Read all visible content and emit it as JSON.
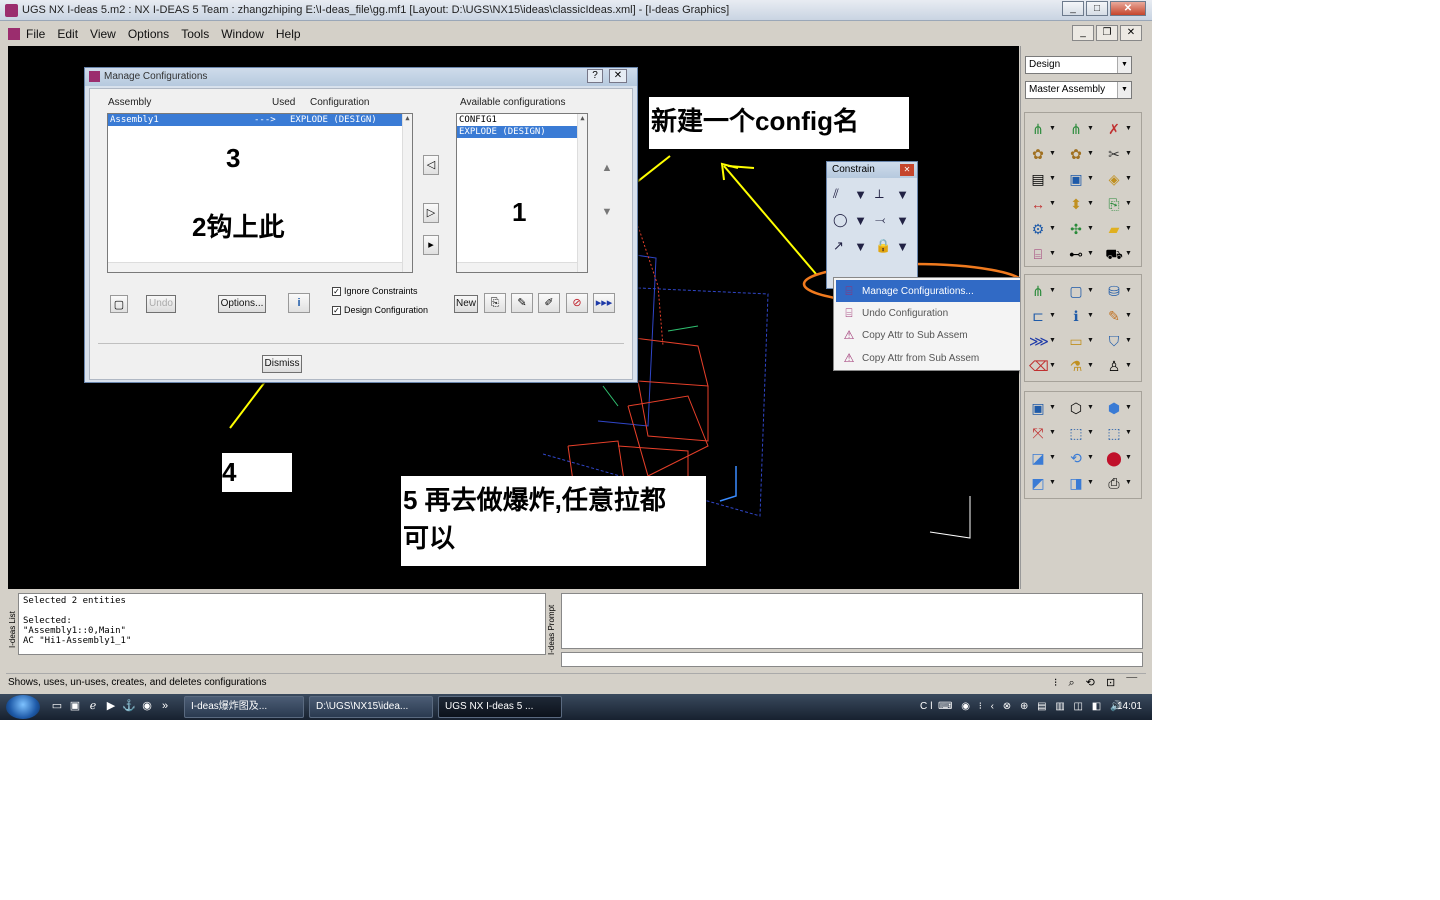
{
  "window": {
    "title": "UGS NX I-deas 5.m2 :    NX I-DEAS 5 Team : zhangzhiping   E:\\I-deas_file\\gg.mf1    [Layout: D:\\UGS\\NX15\\ideas\\classicIdeas.xml]    - [I-deas Graphics]",
    "minimize": "_",
    "maximize": "□",
    "close": "✕"
  },
  "menu": {
    "items": [
      "File",
      "Edit",
      "View",
      "Options",
      "Tools",
      "Window",
      "Help"
    ],
    "mdi_minimize": "_",
    "mdi_restore": "❐",
    "mdi_close": "✕"
  },
  "dialog": {
    "title": "Manage Configurations",
    "help": "?",
    "close": "✕",
    "col_assembly": "Assembly",
    "col_used": "Used",
    "col_configuration": "Configuration",
    "col_available": "Available configurations",
    "assembly_row": {
      "assembly": "Assembly1",
      "used": "--->",
      "configuration": "EXPLODE (DESIGN)"
    },
    "available": [
      "CONFIG1",
      "EXPLODE (DESIGN)"
    ],
    "btn_undo": "Undo",
    "btn_options": "Options...",
    "btn_new": "New",
    "btn_dismiss": "Dismiss",
    "chk_ignore": "Ignore Constraints",
    "chk_design": "Design Configuration",
    "check_mark": "✓"
  },
  "annotations": {
    "a1": "1",
    "a2": "2钩上此",
    "a3": "3",
    "a4": "4",
    "a5_line1": "5 再去做爆炸,任意拉都",
    "a5_line2": "可以",
    "new_config": "新建一个config名"
  },
  "constrain_palette": {
    "title": "Constrain",
    "close": "✕"
  },
  "popup_menu": {
    "items": [
      {
        "label": "Manage Configurations...",
        "selected": true
      },
      {
        "label": "Undo Configuration",
        "selected": false
      },
      {
        "label": "Copy Attr to Sub Assem",
        "selected": false
      },
      {
        "label": "Copy Attr from Sub Assem",
        "selected": false
      }
    ]
  },
  "right_panel": {
    "task_combo": "Design",
    "mode_combo": "Master Assembly"
  },
  "list_panel": {
    "label": "I-deas List",
    "text": "Selected 2 entities\n\nSelected:\n\"Assembly1::0,Main\"\nAC \"Hi1-Assembly1_1\""
  },
  "prompt_panel": {
    "label": "I-deas Prompt"
  },
  "status": {
    "text": "Shows, uses, un-uses, creates, and deletes configurations"
  },
  "taskbar": {
    "tasks": [
      "I-deas爆炸图及...",
      "D:\\UGS\\NX15\\idea...",
      "UGS NX I-deas 5 ..."
    ],
    "clock": "14:01",
    "tray_lang": "Cl"
  },
  "colors": {
    "annotation_arrow": "#ffff00",
    "highlight_ellipse": "#f07a1e",
    "model_red": "#e8402a",
    "model_blue": "#3046c8",
    "selection_blue": "#3a7bd5"
  }
}
